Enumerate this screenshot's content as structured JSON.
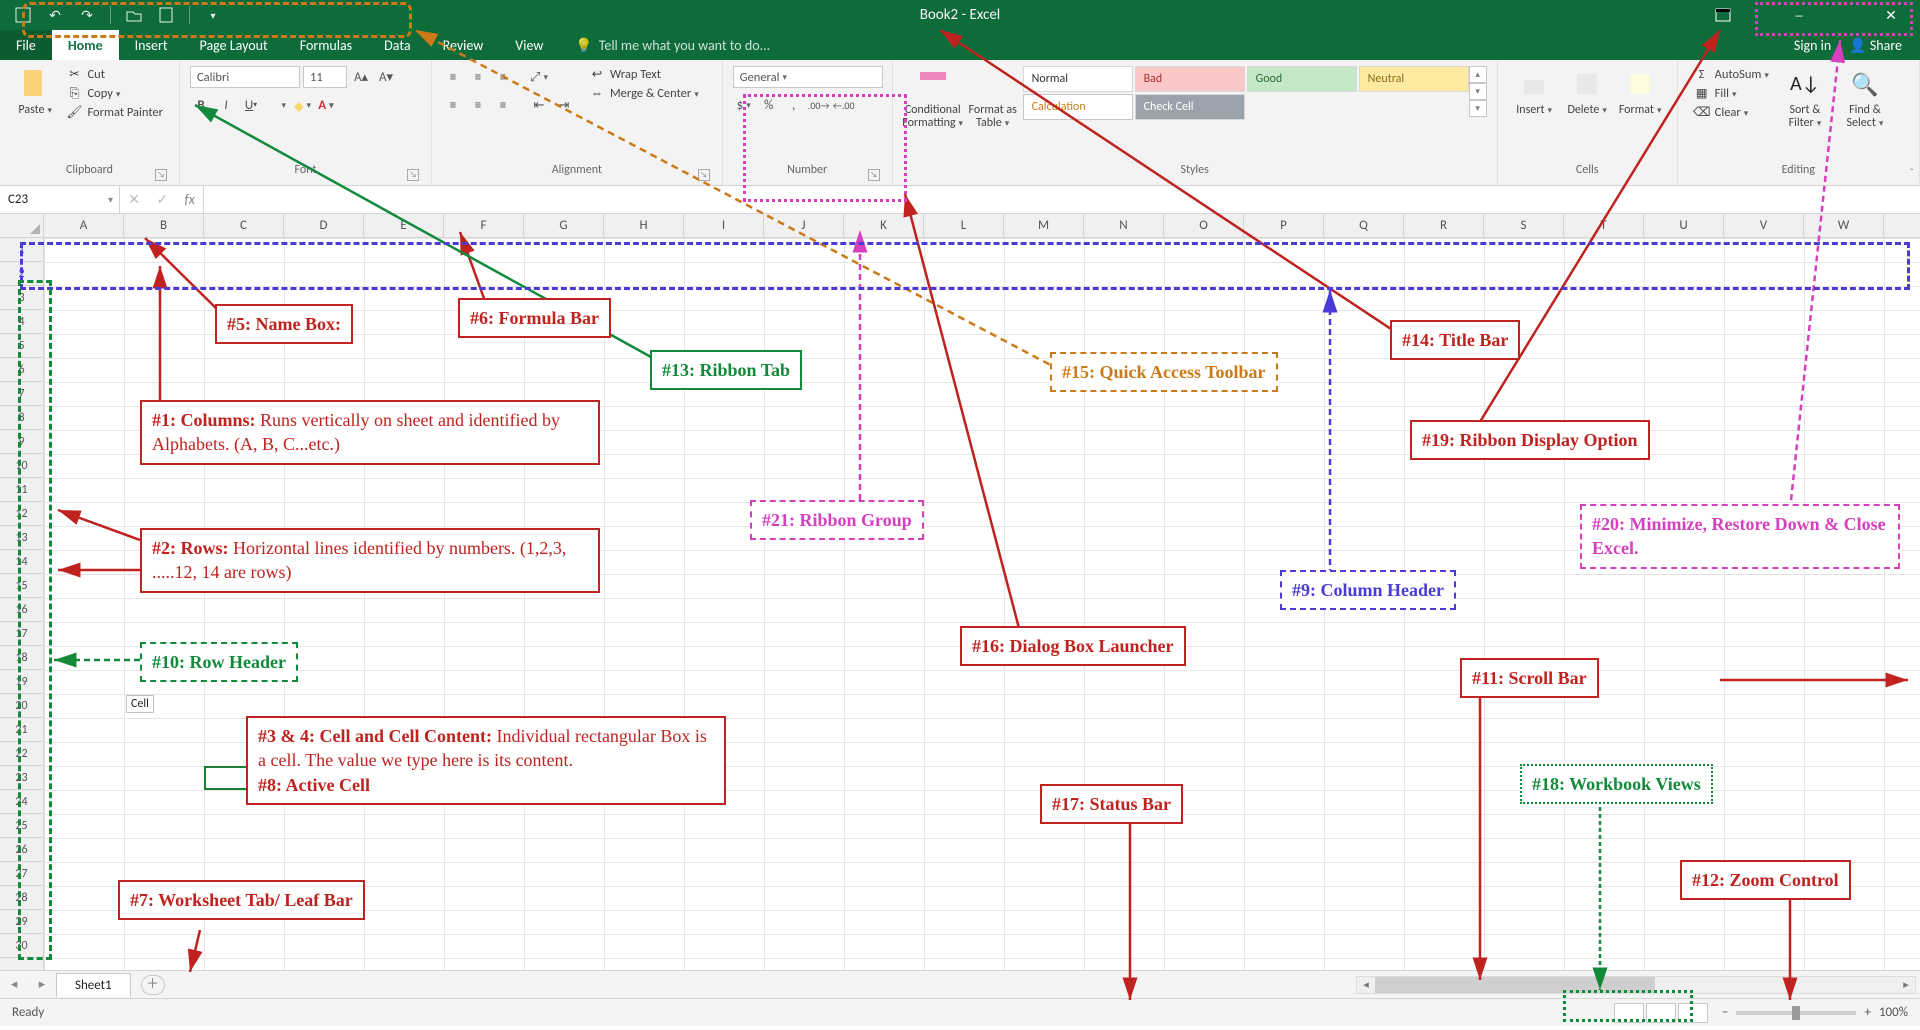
{
  "title": "Book2 - Excel",
  "qat_icons": [
    "save-icon",
    "undo-icon",
    "redo-icon",
    "sep",
    "open-icon",
    "new-icon",
    "sep",
    "customize-icon"
  ],
  "win_icons": [
    "ribbon-options-icon",
    "minimize-icon",
    "restore-icon",
    "close-icon"
  ],
  "tabs": [
    "File",
    "Home",
    "Insert",
    "Page Layout",
    "Formulas",
    "Data",
    "Review",
    "View"
  ],
  "tellme": "Tell me what you want to do...",
  "signin": "Sign in",
  "share": "Share",
  "ribbon": {
    "clipboard": {
      "label": "Clipboard",
      "paste": "Paste",
      "cut": "Cut",
      "copy": "Copy",
      "fp": "Format Painter"
    },
    "font": {
      "label": "Font",
      "name": "Calibri",
      "size": "11"
    },
    "alignment": {
      "label": "Alignment",
      "wrap": "Wrap Text",
      "merge": "Merge & Center"
    },
    "number": {
      "label": "Number",
      "format": "General"
    },
    "stylesLabel": "Styles",
    "cond": "Conditional Formatting",
    "fat": "Format as Table",
    "cellstyles": [
      {
        "t": "Normal",
        "bg": "#ffffff",
        "fg": "#333"
      },
      {
        "t": "Bad",
        "bg": "#f9c7c5",
        "fg": "#a33"
      },
      {
        "t": "Good",
        "bg": "#c5e8c8",
        "fg": "#2d6b33"
      },
      {
        "t": "Neutral",
        "bg": "#feeaa0",
        "fg": "#8a6d1a"
      },
      {
        "t": "Calculation",
        "bg": "#fff",
        "fg": "#c77f1a",
        "bd": "#c8c8c8"
      },
      {
        "t": "Check Cell",
        "bg": "#9aa3ab",
        "fg": "#fff"
      }
    ],
    "cells": {
      "label": "Cells",
      "insert": "Insert",
      "delete": "Delete",
      "format": "Format"
    },
    "editing": {
      "label": "Editing",
      "autosum": "AutoSum",
      "fill": "Fill",
      "clear": "Clear",
      "sort": "Sort & Filter",
      "find": "Find & Select"
    }
  },
  "namebox": "C23",
  "fx": "fx",
  "columns": [
    "A",
    "B",
    "C",
    "D",
    "E",
    "F",
    "G",
    "H",
    "I",
    "J",
    "K",
    "L",
    "M",
    "N",
    "O",
    "P",
    "Q",
    "R",
    "S",
    "T",
    "U",
    "V",
    "W"
  ],
  "rows": 30,
  "incell": "Cell",
  "sheets": [
    "Sheet1"
  ],
  "status": "Ready",
  "zoom": "100%",
  "annotations": {
    "a1": {
      "pre": "#1: Columns: ",
      "txt": "Runs vertically on sheet and identified by Alphabets. (A, B, C...etc.)"
    },
    "a2": {
      "pre": "#2: Rows: ",
      "txt": "Horizontal lines identified by numbers. (1,2,3, .....12, 14 are rows)"
    },
    "a3": {
      "pre": "#3 & 4: Cell and Cell Content: ",
      "txt": "Individual rectangular Box is a cell. The value we type here is its content."
    },
    "a8": "#8: Active Cell",
    "a5": "#5: Name Box:",
    "a6": "#6: Formula Bar",
    "a7": "#7: Worksheet Tab/ Leaf Bar",
    "a9": "#9: Column Header",
    "a10": "#10: Row Header",
    "a11": "#11: Scroll Bar",
    "a12": "#12: Zoom Control",
    "a13": "#13: Ribbon Tab",
    "a14": "#14: Title Bar",
    "a15": "#15: Quick Access Toolbar",
    "a16": "#16: Dialog Box Launcher",
    "a17": "#17: Status Bar",
    "a18": "#18: Workbook Views",
    "a19": "#19: Ribbon Display Option",
    "a20": "#20: Minimize, Restore Down & Close Excel.",
    "a21": "#21: Ribbon Group"
  }
}
